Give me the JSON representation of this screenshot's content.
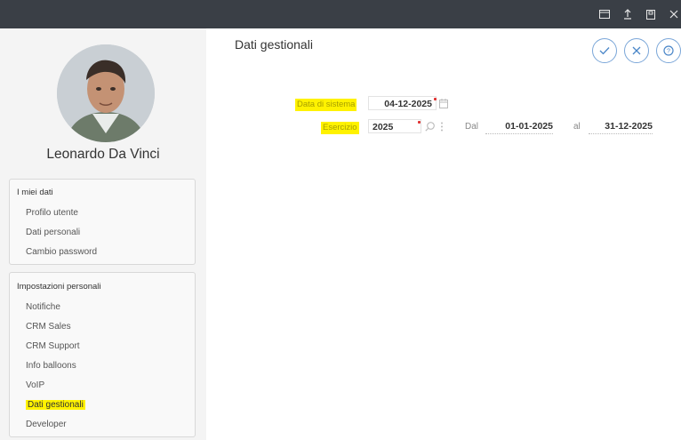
{
  "window": {
    "title_bar_icons": [
      "window-icon",
      "upload-icon",
      "save-icon",
      "close-icon"
    ]
  },
  "user": {
    "name": "Leonardo Da Vinci"
  },
  "sidebar": {
    "section1": {
      "title": "I miei dati",
      "items": [
        "Profilo utente",
        "Dati personali",
        "Cambio password"
      ]
    },
    "section2": {
      "title": "Impostazioni personali",
      "items": [
        "Notifiche",
        "CRM Sales",
        "CRM Support",
        "Info balloons",
        "VoIP",
        "Dati gestionali",
        "Developer"
      ],
      "selected": "Dati gestionali"
    }
  },
  "main": {
    "title": "Dati gestionali",
    "actions": [
      "confirm-icon",
      "cancel-icon",
      "help-icon"
    ],
    "form": {
      "data_sistema_label": "Data di sistema",
      "data_sistema_value": "04-12-2025",
      "esercizio_label": "Esercizio",
      "esercizio_value": "2025",
      "dal_label": "Dal",
      "dal_value": "01-01-2025",
      "al_label": "al",
      "al_value": "31-12-2025"
    }
  },
  "colors": {
    "highlight": "#fff200",
    "accent": "#4a86c8",
    "required": "#e03131"
  }
}
